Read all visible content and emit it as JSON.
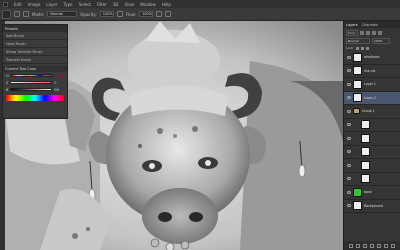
{
  "menubar": {
    "items": [
      "Edit",
      "Image",
      "Layer",
      "Type",
      "Select",
      "Filter",
      "3D",
      "View",
      "Window",
      "Help"
    ]
  },
  "options_bar": {
    "mode_label": "Mode:",
    "mode_value": "Normal",
    "opacity_label": "Opacity:",
    "opacity_value": "100%",
    "flow_label": "Flow:",
    "flow_value": "100%"
  },
  "brush_panel": {
    "tabs": "Presets",
    "brushes": [
      "Soft Brush",
      "Hard Brush",
      "Sharp Transfer Brush",
      "Transfer Brush"
    ],
    "section_title": "Current Tool Color",
    "sliders": [
      {
        "label": "H",
        "value": "",
        "fill": 0.0
      },
      {
        "label": "S",
        "value": "0",
        "fill": 0.0
      },
      {
        "label": "B",
        "value": "96",
        "fill": 0.96
      }
    ]
  },
  "layers_panel": {
    "tabs": [
      "Layers",
      "Channels"
    ],
    "kind_label": "Kind",
    "blend_mode": "Normal",
    "opacity": "100%",
    "lock_label": "Lock:",
    "layers": [
      {
        "name": "whaHoms",
        "selected": false,
        "group": false,
        "indent": false
      },
      {
        "name": "line art",
        "selected": false,
        "group": false,
        "indent": false
      },
      {
        "name": "Layer 1",
        "selected": false,
        "group": false,
        "indent": false
      },
      {
        "name": "Layer 2",
        "selected": true,
        "group": false,
        "indent": false
      },
      {
        "name": "Group 1",
        "selected": false,
        "group": true,
        "indent": false
      },
      {
        "name": "",
        "selected": false,
        "group": false,
        "indent": true
      },
      {
        "name": "",
        "selected": false,
        "group": false,
        "indent": true
      },
      {
        "name": "",
        "selected": false,
        "group": false,
        "indent": true
      },
      {
        "name": "",
        "selected": false,
        "group": false,
        "indent": true
      },
      {
        "name": "",
        "selected": false,
        "group": false,
        "indent": true
      },
      {
        "name": "base",
        "selected": false,
        "group": false,
        "indent": false
      },
      {
        "name": "Background",
        "selected": false,
        "group": false,
        "indent": false
      }
    ]
  },
  "colors": {
    "selected_layer": "#4a5670",
    "base_thumb": "#3fbf3f"
  }
}
